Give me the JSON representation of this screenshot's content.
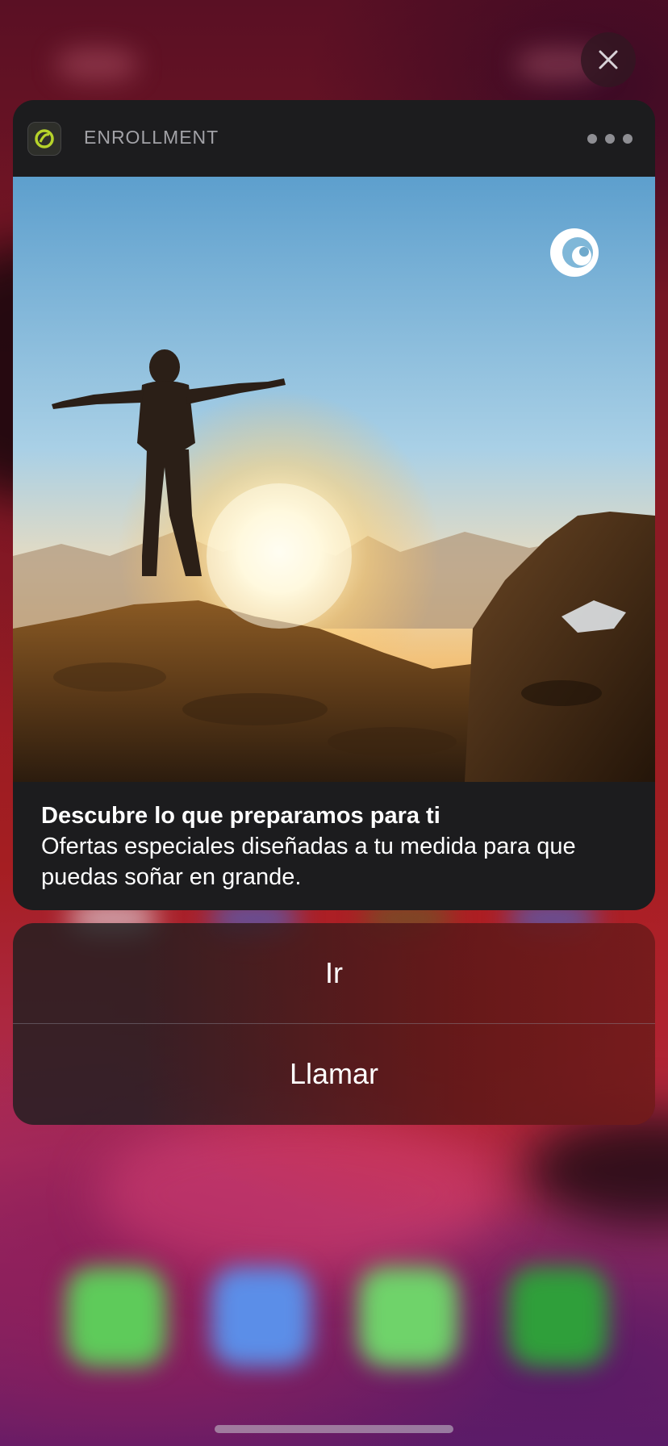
{
  "notification": {
    "app_name": "ENROLLMENT",
    "title": "Descubre lo que preparamos para ti",
    "message": "Ofertas especiales diseñadas a tu medida para que puedas soñar en grande.",
    "image_description": "person-on-mountain-at-sunrise"
  },
  "actions": [
    {
      "label": "Ir"
    },
    {
      "label": "Llamar"
    }
  ],
  "icons": {
    "close": "close-icon",
    "more": "ellipsis-icon",
    "app": "enrollment-app-icon",
    "brand": "brand-logo-icon"
  },
  "colors": {
    "card_background": "#1c1c1e",
    "app_name_text": "#a2a2a7",
    "app_icon_accent": "#b6d32a"
  }
}
